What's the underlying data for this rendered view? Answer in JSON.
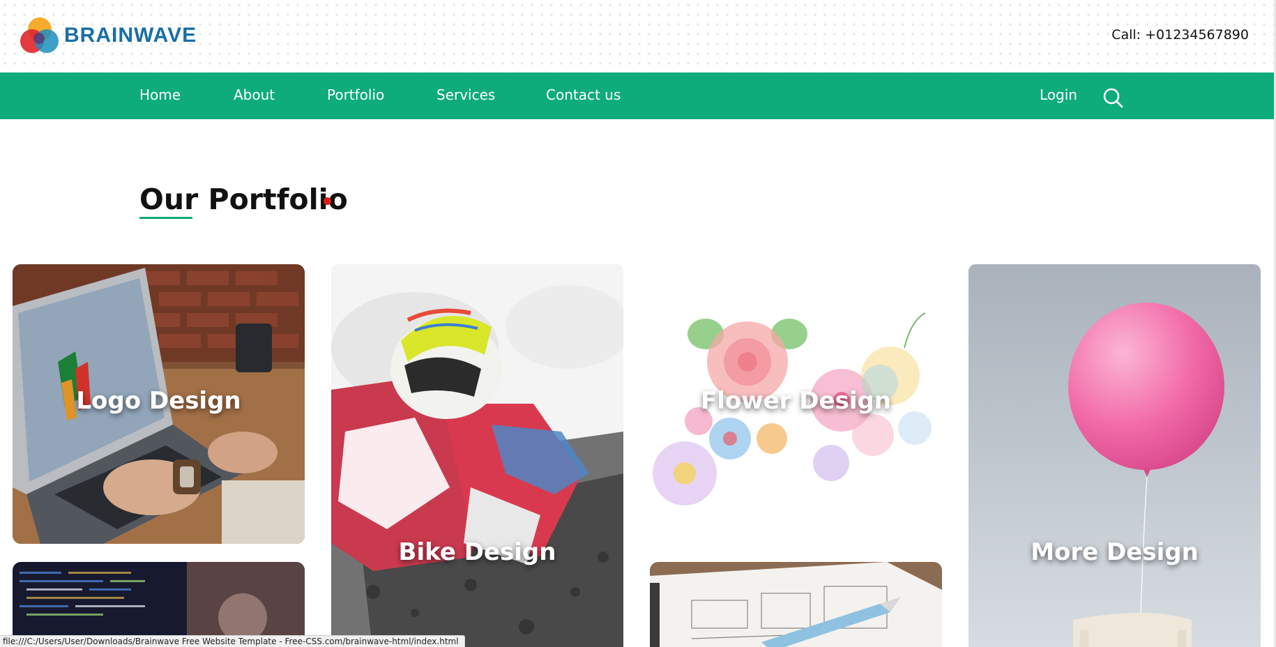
{
  "header": {
    "logo_text": "BRAINWAVE",
    "call_text": "Call: +01234567890"
  },
  "nav": {
    "items": [
      {
        "label": "Home"
      },
      {
        "label": "About"
      },
      {
        "label": "Portfolio"
      },
      {
        "label": "Services"
      },
      {
        "label": "Contact us"
      }
    ],
    "login_label": "Login",
    "search_icon": "search-icon"
  },
  "portfolio": {
    "title": "Our Portfolio",
    "cards": [
      {
        "label": "Logo Design"
      },
      {
        "label": "Bike Design"
      },
      {
        "label": "Flower Design"
      },
      {
        "label": "More Design"
      }
    ]
  },
  "status_bar": {
    "url": "file:///C:/Users/User/Downloads/Brainwave Free Website Template - Free-CSS.com/brainwave-html/index.html"
  },
  "colors": {
    "nav_green": "#0eab7b",
    "logo_blue": "#1a6ea6",
    "accent_red": "#e01b1b"
  }
}
